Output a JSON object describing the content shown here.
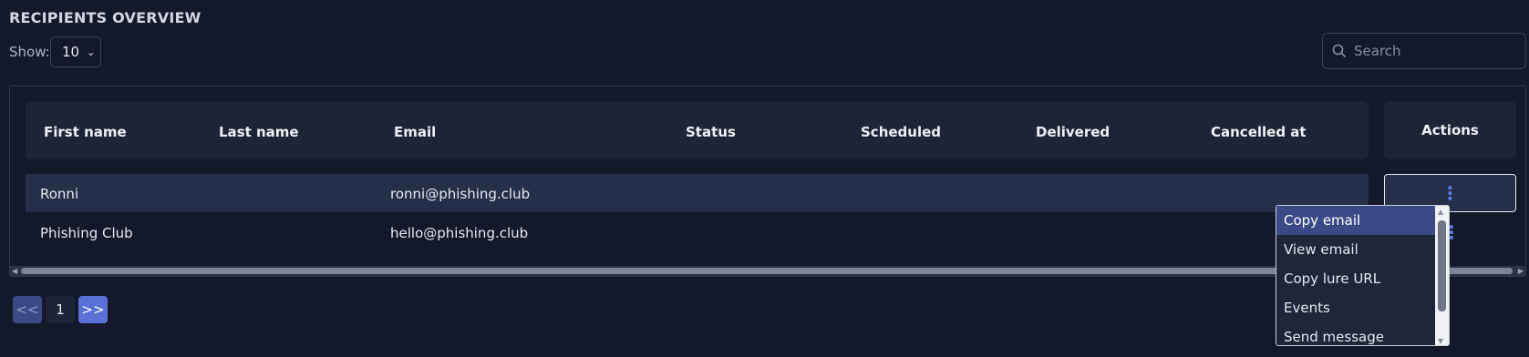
{
  "page": {
    "title": "RECIPIENTS OVERVIEW"
  },
  "controls": {
    "show_label": "Show:",
    "page_size": "10",
    "search_placeholder": "Search"
  },
  "table": {
    "columns": [
      "First name",
      "Last name",
      "Email",
      "Status",
      "Scheduled",
      "Delivered",
      "Cancelled at"
    ],
    "actions_header": "Actions",
    "rows": [
      {
        "first_name": "Ronni",
        "last_name": "",
        "email": "ronni@phishing.club",
        "status": "",
        "scheduled": "",
        "delivered": "",
        "cancelled_at": ""
      },
      {
        "first_name": "Phishing Club",
        "last_name": "",
        "email": "hello@phishing.club",
        "status": "",
        "scheduled": "",
        "delivered": "",
        "cancelled_at": ""
      }
    ]
  },
  "row_menu": {
    "items": [
      "Copy email",
      "View email",
      "Copy lure URL",
      "Events",
      "Send message"
    ],
    "highlighted_index": 0
  },
  "pagination": {
    "prev": "<<",
    "current": "1",
    "next": ">>"
  },
  "icons": {
    "search": "search-icon",
    "kebab": "kebab-menu-icon",
    "chevron": "chevron-down-icon"
  },
  "colors": {
    "background": "#13192a",
    "header_bg": "#1c2435",
    "row_highlight": "#262f4a",
    "accent": "#5a72d6"
  }
}
